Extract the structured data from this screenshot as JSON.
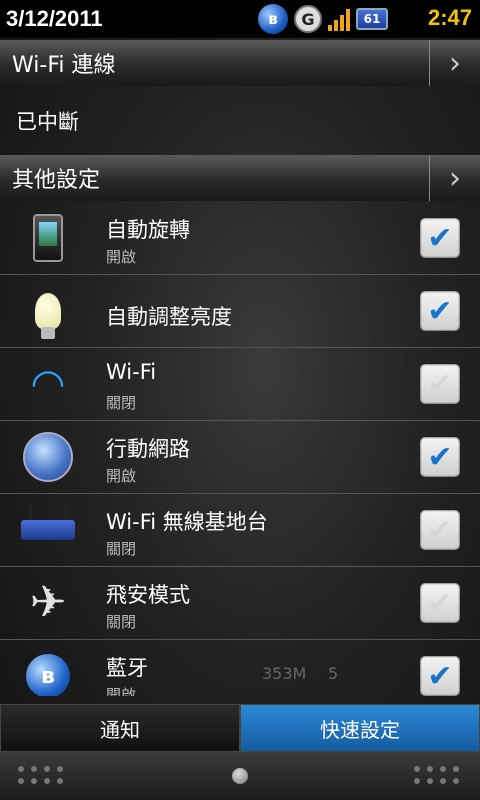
{
  "status_bar": {
    "date": "3/12/2011",
    "g_label": "G",
    "battery": "61",
    "time": "2:47"
  },
  "wifi_section": {
    "title": "Wi-Fi 連線",
    "status": "已中斷"
  },
  "other_section": {
    "title": "其他設定"
  },
  "settings": [
    {
      "title": "自動旋轉",
      "subtitle": "開啟",
      "checked": true,
      "icon": "phone-icon"
    },
    {
      "title": "自動調整亮度",
      "subtitle": "",
      "checked": true,
      "icon": "bulb-icon"
    },
    {
      "title": "Wi-Fi",
      "subtitle": "關閉",
      "checked": false,
      "icon": "wifi-icon"
    },
    {
      "title": "行動網路",
      "subtitle": "開啟",
      "checked": true,
      "icon": "globe-icon"
    },
    {
      "title": "Wi-Fi 無線基地台",
      "subtitle": "關閉",
      "checked": false,
      "icon": "router-icon"
    },
    {
      "title": "飛安模式",
      "subtitle": "關閉",
      "checked": false,
      "icon": "airplane-icon"
    },
    {
      "title": "藍牙",
      "subtitle": "開啟",
      "checked": true,
      "icon": "bluetooth-icon"
    }
  ],
  "overlay": {
    "memory": "353M",
    "count": "5"
  },
  "tabs": {
    "notifications": "通知",
    "quick_settings": "快速設定"
  }
}
